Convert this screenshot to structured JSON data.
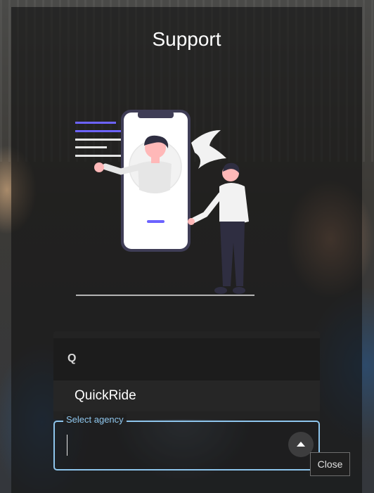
{
  "dialog": {
    "title": "Support"
  },
  "agency_select": {
    "search_text": "Q",
    "options": [
      {
        "label": "QuickRide"
      }
    ],
    "field_label": "Select agency",
    "value": ""
  },
  "close_tooltip": "Close",
  "colors": {
    "accent": "#8ec5ec",
    "illustration_purple": "#6c63ff",
    "illustration_dark": "#2f2e41"
  },
  "illustration": "support-illustration"
}
